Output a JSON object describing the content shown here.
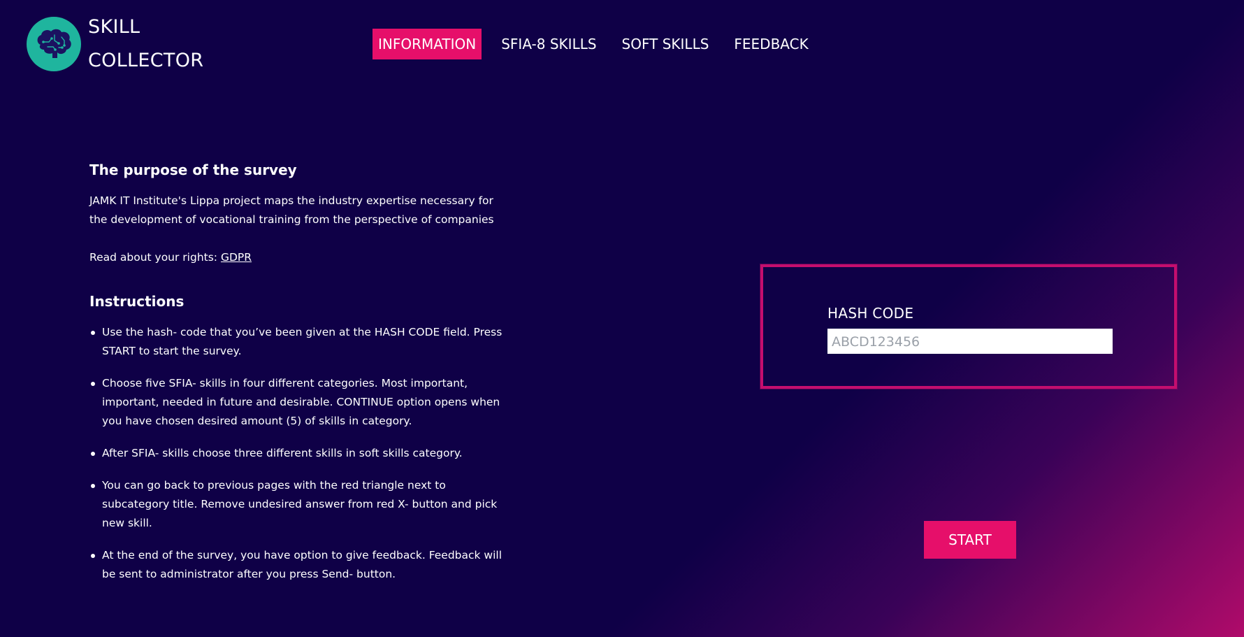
{
  "app": {
    "logo_line1": "SKILL",
    "logo_line2": "COLLECTOR"
  },
  "nav": {
    "items": [
      {
        "label": "INFORMATION",
        "active": true
      },
      {
        "label": "SFIA-8 SKILLS",
        "active": false
      },
      {
        "label": "SOFT SKILLS",
        "active": false
      },
      {
        "label": "FEEDBACK",
        "active": false
      }
    ]
  },
  "purpose": {
    "title": "The purpose of the survey",
    "text": "JAMK IT Institute's Lippa project maps the industry expertise necessary for the development of vocational training from the perspective of companies",
    "rights_prefix": "Read about your rights: ",
    "rights_link": "GDPR"
  },
  "instructions": {
    "title": "Instructions",
    "items": [
      "Use the hash- code that you’ve been given at the HASH CODE field. Press START to start the survey.",
      "Choose five SFIA- skills in four different categories. Most important, important, needed in future and desirable. CONTINUE option opens when you have chosen desired amount (5) of skills in category.",
      "After SFIA- skills choose three different skills in soft skills category.",
      "You can go back to previous pages with the red triangle next to subcategory title. Remove undesired answer from red X- button and pick new skill.",
      "At the end of the survey, you have option to give feedback. Feedback will be sent to administrator after you press Send- button."
    ]
  },
  "hash": {
    "label": "HASH CODE",
    "value": "",
    "placeholder": "ABCD123456"
  },
  "start": {
    "label": "START"
  },
  "colors": {
    "background": "#0f0047",
    "accent": "#e60f6a",
    "panel_border": "#c40e6e",
    "logo_circle": "#1fb59e"
  },
  "icons": {
    "logo": "brain-circuit-icon"
  }
}
